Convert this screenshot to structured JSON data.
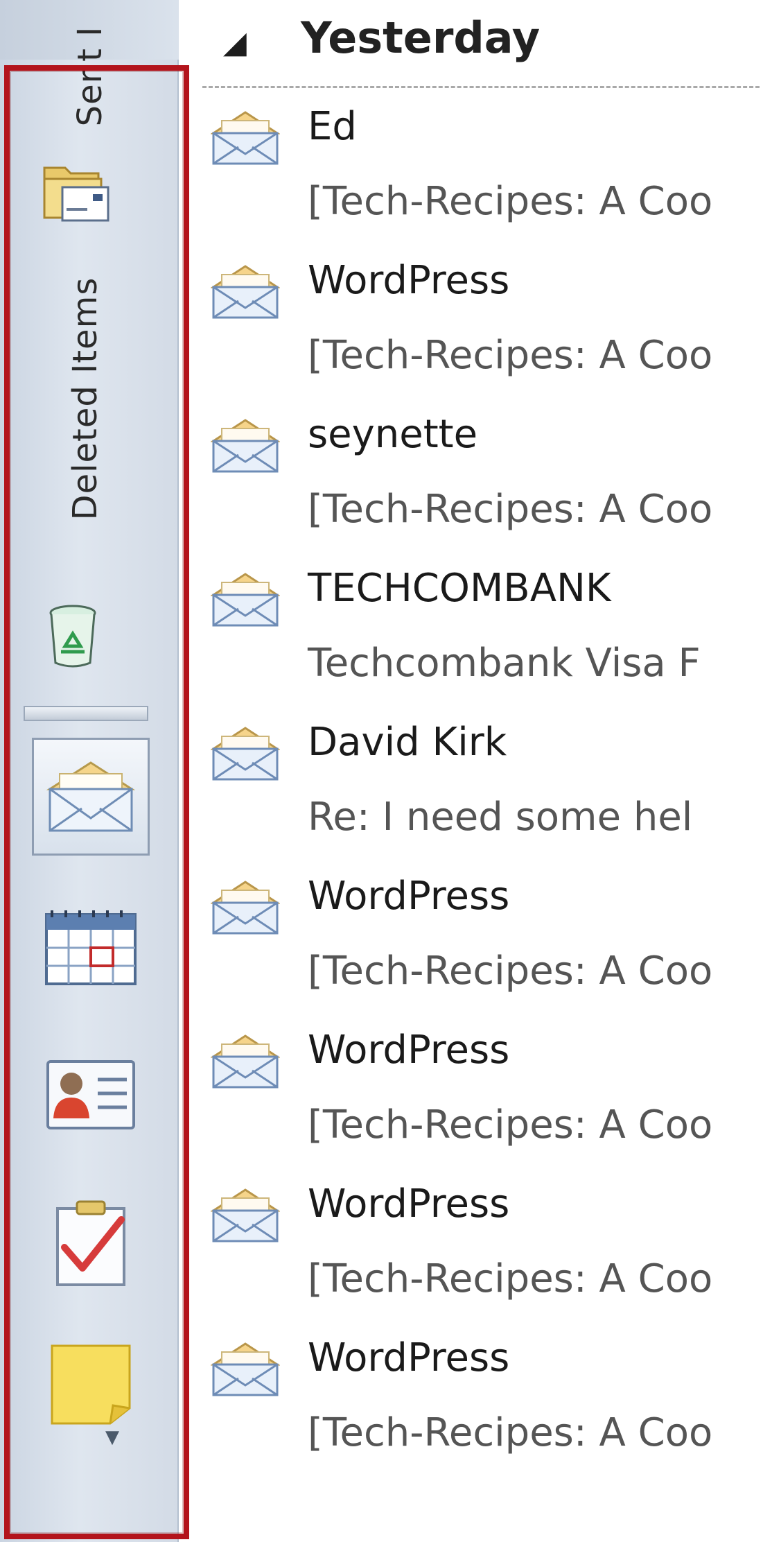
{
  "navigation_pane": {
    "folders": [
      {
        "label": "Sent I",
        "icon": "sent-items-folder-icon"
      },
      {
        "label": "Deleted Items",
        "icon": "recycle-bin-icon"
      }
    ],
    "modules": [
      {
        "name": "mail",
        "icon": "mail-icon",
        "selected": true
      },
      {
        "name": "calendar",
        "icon": "calendar-icon",
        "selected": false
      },
      {
        "name": "contacts",
        "icon": "contacts-icon",
        "selected": false
      },
      {
        "name": "tasks",
        "icon": "tasks-icon",
        "selected": false
      },
      {
        "name": "notes",
        "icon": "notes-icon",
        "selected": false
      }
    ],
    "highlight_color": "#b3141c"
  },
  "message_list": {
    "group": {
      "label": "Yesterday",
      "expanded": true
    },
    "items": [
      {
        "sender": "Ed",
        "subject": "[Tech-Recipes: A Coo"
      },
      {
        "sender": "WordPress",
        "subject": "[Tech-Recipes: A Coo"
      },
      {
        "sender": "seynette",
        "subject": "[Tech-Recipes: A Coo"
      },
      {
        "sender": "TECHCOMBANK",
        "subject": "Techcombank Visa F"
      },
      {
        "sender": "David Kirk",
        "subject": "Re: I need some hel"
      },
      {
        "sender": "WordPress",
        "subject": "[Tech-Recipes: A Coo"
      },
      {
        "sender": "WordPress",
        "subject": "[Tech-Recipes: A Coo"
      },
      {
        "sender": "WordPress",
        "subject": "[Tech-Recipes: A Coo"
      },
      {
        "sender": "WordPress",
        "subject": "[Tech-Recipes: A Coo"
      }
    ]
  }
}
